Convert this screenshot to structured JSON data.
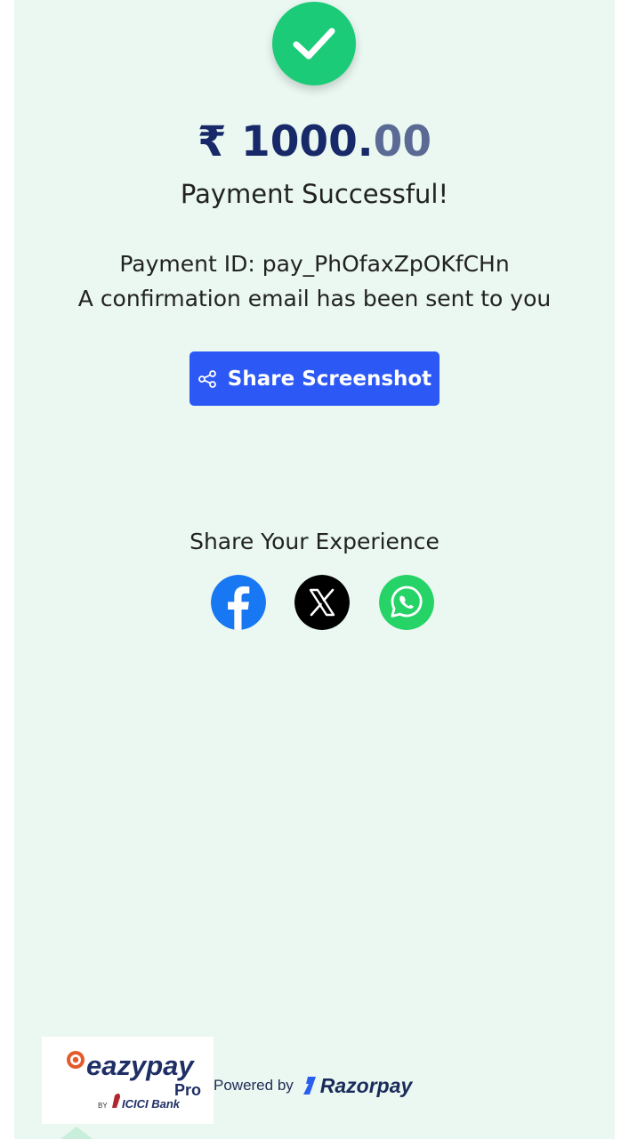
{
  "status": {
    "icon": "check-icon",
    "amount_main": "₹ 1000.",
    "amount_paise": "00",
    "title": "Payment Successful!",
    "payment_id": "Payment ID: pay_PhOfaxZpOKfCHn",
    "confirmation": "A confirmation email has been sent to you"
  },
  "actions": {
    "share_screenshot_label": "Share Screenshot",
    "share_icon": "share-icon"
  },
  "share": {
    "title": "Share Your Experience",
    "icons": [
      "facebook-icon",
      "x-icon",
      "whatsapp-icon"
    ]
  },
  "footer": {
    "brand_name": "eazypay",
    "brand_suffix": "Pro",
    "brand_by": "BY",
    "bank_name": "ICICI Bank",
    "powered_by": "Powered by",
    "provider": "Razorpay"
  },
  "colors": {
    "background": "#eaf8f1",
    "success": "#1ccb78",
    "amount": "#18296a",
    "button": "#2c58f5",
    "facebook": "#1877f2",
    "whatsapp": "#25d366"
  }
}
